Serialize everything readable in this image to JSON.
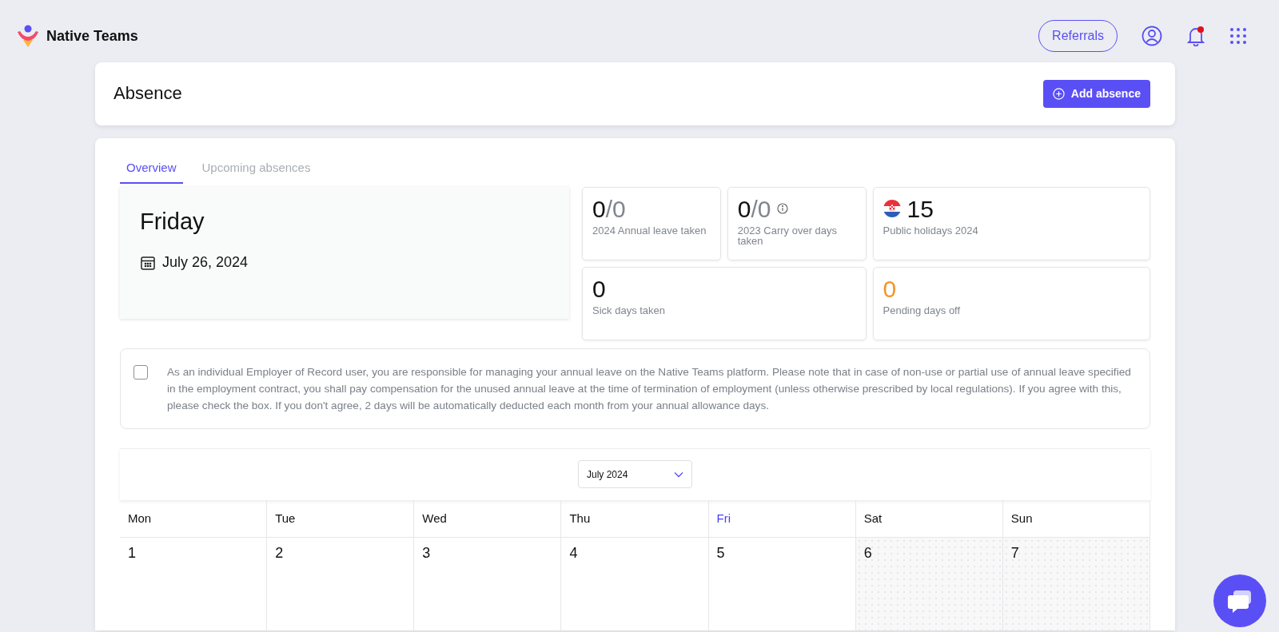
{
  "header": {
    "brand": "Native Teams",
    "referrals": "Referrals",
    "has_unread_notifications": true
  },
  "page": {
    "title": "Absence",
    "add_button": "Add absence"
  },
  "tabs": [
    {
      "label": "Overview",
      "selected": true
    },
    {
      "label": "Upcoming absences",
      "selected": false
    }
  ],
  "today": {
    "weekday": "Friday",
    "date": "July 26, 2024"
  },
  "stats": [
    {
      "kind": "fraction",
      "value": "0",
      "total": "/0",
      "label": "2024 Annual leave taken",
      "info": false
    },
    {
      "kind": "fraction",
      "value": "0",
      "total": "/0",
      "label": "2023 Carry over days taken",
      "info": true
    },
    {
      "kind": "holidays",
      "value": "15",
      "label": "Public holidays 2024"
    },
    {
      "kind": "count",
      "value": "0",
      "label": "Sick days taken",
      "wide": true
    },
    {
      "kind": "pending",
      "value": "0",
      "label": "Pending days off"
    }
  ],
  "notice": {
    "checked": false,
    "text": "As an individual Employer of Record user, you are responsible for managing your annual leave on the Native Teams platform. Please note that in case of non-use or partial use of annual leave specified in the employment contract, you shall pay compensation for the unused annual leave at the time of termination of employment (unless otherwise prescribed by local regulations). If you agree with this, please check the box. If you don't agree, 2 days will be automatically deducted each month from your annual allowance days."
  },
  "calendar": {
    "month": "July 2024",
    "weekdays": [
      {
        "label": "Mon",
        "selected": false
      },
      {
        "label": "Tue",
        "selected": false
      },
      {
        "label": "Wed",
        "selected": false
      },
      {
        "label": "Thu",
        "selected": false
      },
      {
        "label": "Fri",
        "selected": true
      },
      {
        "label": "Sat",
        "selected": false
      },
      {
        "label": "Sun",
        "selected": false
      }
    ],
    "days": [
      {
        "number": "1",
        "weekend": false
      },
      {
        "number": "2",
        "weekend": false
      },
      {
        "number": "3",
        "weekend": false
      },
      {
        "number": "4",
        "weekend": false
      },
      {
        "number": "5",
        "weekend": false
      },
      {
        "number": "6",
        "weekend": true
      },
      {
        "number": "7",
        "weekend": true
      }
    ]
  }
}
